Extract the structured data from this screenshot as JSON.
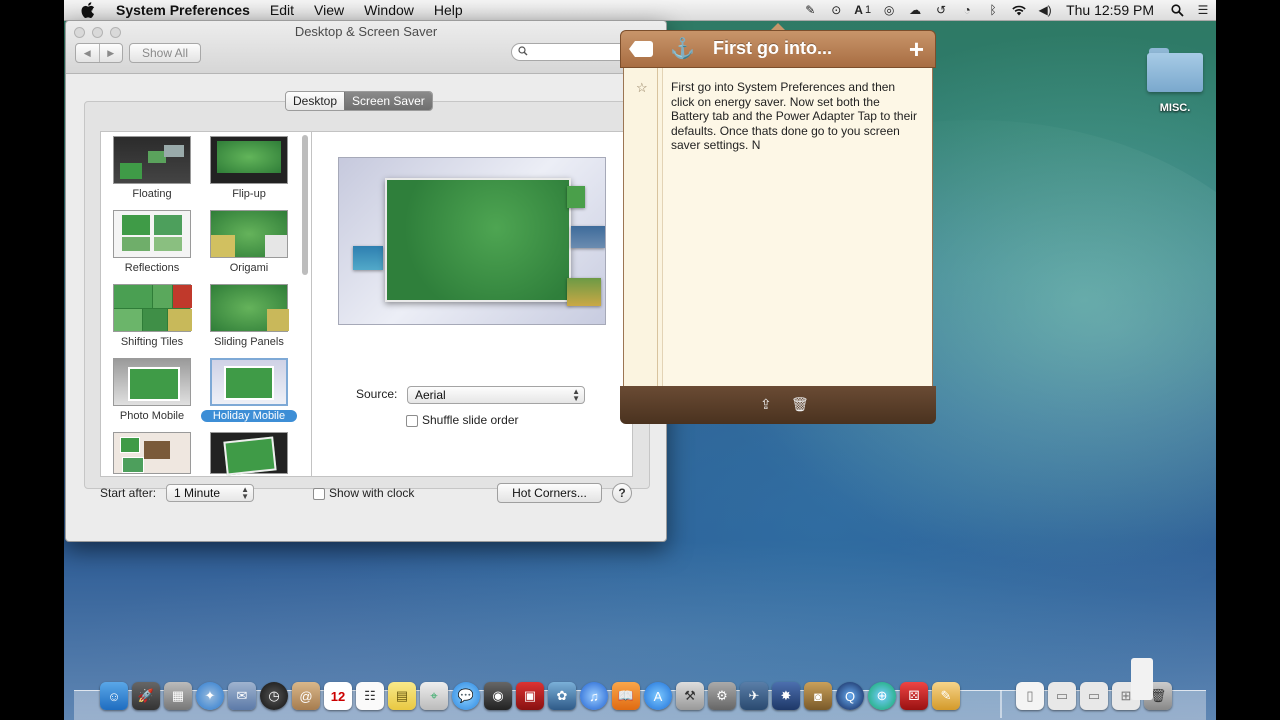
{
  "menubar": {
    "app_name": "System Preferences",
    "items": [
      "Edit",
      "View",
      "Window",
      "Help"
    ],
    "clock": "Thu 12:59 PM",
    "adobe_badge": "1"
  },
  "window": {
    "title": "Desktop & Screen Saver",
    "show_all": "Show All",
    "search_placeholder": "",
    "tabs": [
      {
        "label": "Desktop",
        "selected": false
      },
      {
        "label": "Screen Saver",
        "selected": true
      }
    ],
    "savers": [
      {
        "label": "Floating",
        "selected": false
      },
      {
        "label": "Flip-up",
        "selected": false
      },
      {
        "label": "Reflections",
        "selected": false
      },
      {
        "label": "Origami",
        "selected": false
      },
      {
        "label": "Shifting Tiles",
        "selected": false
      },
      {
        "label": "Sliding Panels",
        "selected": false
      },
      {
        "label": "Photo Mobile",
        "selected": false
      },
      {
        "label": "Holiday Mobile",
        "selected": true
      },
      {
        "label": "",
        "selected": false
      },
      {
        "label": "",
        "selected": false
      }
    ],
    "source_label": "Source:",
    "source_value": "Aerial",
    "shuffle_label": "Shuffle slide order",
    "start_after_label": "Start after:",
    "start_after_value": "1 Minute",
    "show_clock_label": "Show with clock",
    "hot_corners": "Hot Corners...",
    "help": "?"
  },
  "note": {
    "title": "First go into...",
    "body": "First go into System Preferences and then click on energy saver. Now set both the Battery tab and the Power Adapter Tap to their defaults. Once thats done go to you screen saver settings. N"
  },
  "desktop": {
    "folder_label": "MISC."
  },
  "colors": {
    "selection_blue": "#3d8ed6",
    "note_header": "#b57b4f",
    "note_footer": "#5a3f2a"
  }
}
